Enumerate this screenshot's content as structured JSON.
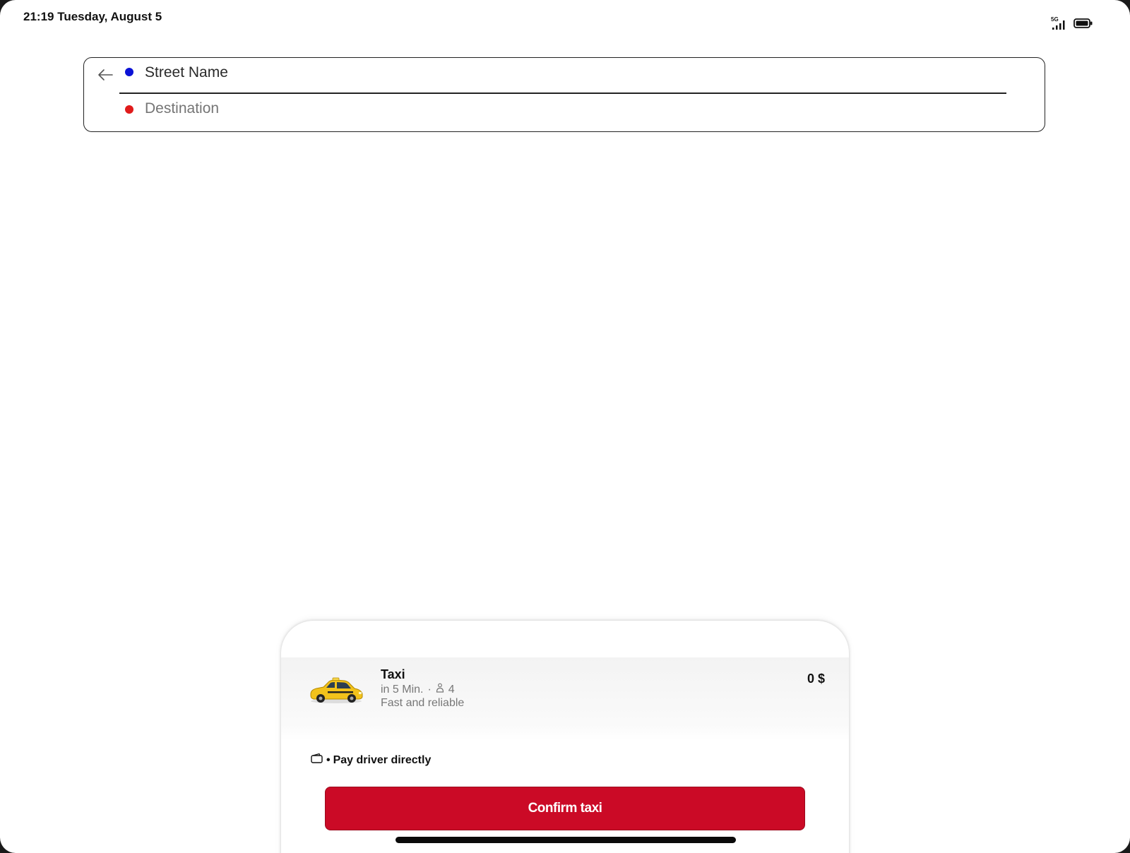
{
  "status_bar": {
    "time_date": "21:19 Tuesday, August 5",
    "signal_icon": "cellular-5g-icon",
    "battery_icon": "battery-icon"
  },
  "route": {
    "back_icon": "back-arrow-icon",
    "origin_value": "Street Name",
    "destination_value": "Destination",
    "origin_color": "#0b12d6",
    "destination_color": "#e01b1b"
  },
  "ride_option": {
    "icon": "taxi-car-icon",
    "name": "Taxi",
    "eta": "in 5 Min.",
    "separator": "·",
    "seats_icon": "person-icon",
    "seats": "4",
    "description": "Fast and reliable",
    "price": "0 $"
  },
  "payment": {
    "icon": "wallet-icon",
    "separator": "•",
    "label": "Pay driver directly"
  },
  "confirm_button": {
    "label": "Confirm taxi",
    "color": "#cb0a26"
  }
}
